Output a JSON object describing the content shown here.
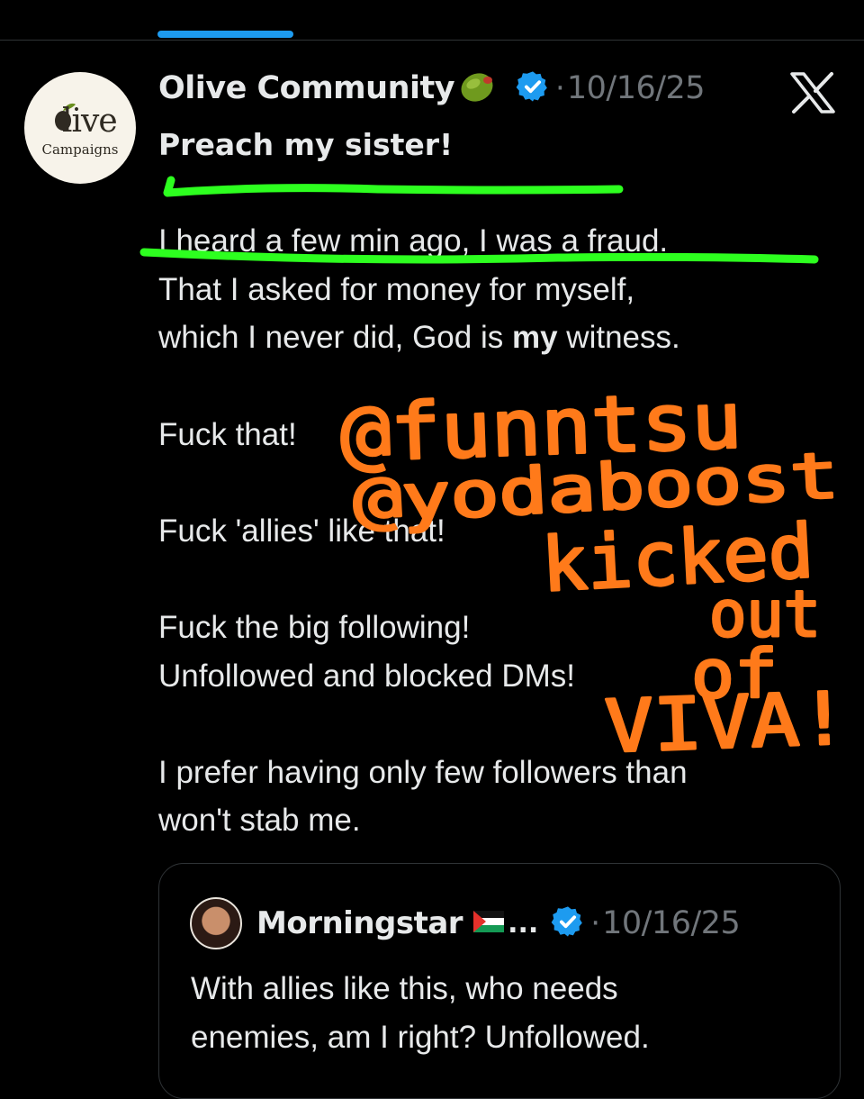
{
  "post": {
    "display_name": "Olive Community",
    "date": "10/16/25",
    "separator": "·",
    "avatar": {
      "logo_word": "live",
      "logo_sub": "Campaigns"
    },
    "lines": {
      "l1": "Preach my sister!",
      "l2": "I heard a few min ago, I was a fraud.",
      "l3": "That I asked for money for myself,",
      "l4a": "which I never did, God is ",
      "l4b": "my",
      "l4c": " witness.",
      "l5": "Fuck that!",
      "l6": "Fuck 'allies' like that!",
      "l7": "Fuck the big following!",
      "l8": "Unfollowed and blocked DMs!",
      "l9": "I prefer having only few followers than",
      "l10": "won't stab me."
    }
  },
  "quote": {
    "name": "Morningstar",
    "ellipsis": "...",
    "date": "10/16/25",
    "separator": "·",
    "lines": {
      "q1": "With allies like this, who needs",
      "q2": "enemies, am I right? Unfollowed."
    }
  },
  "annotation": {
    "lines": [
      "@funntsu",
      "@yodaboost",
      "kicked",
      "out",
      "of",
      "VIVA!"
    ],
    "colors": {
      "handwriting": "#ff7a1a",
      "highlight": "#2dff1f"
    }
  },
  "colors": {
    "verified": "#1d9bf0",
    "accent": "#1d9bf0",
    "muted": "#71767b"
  }
}
